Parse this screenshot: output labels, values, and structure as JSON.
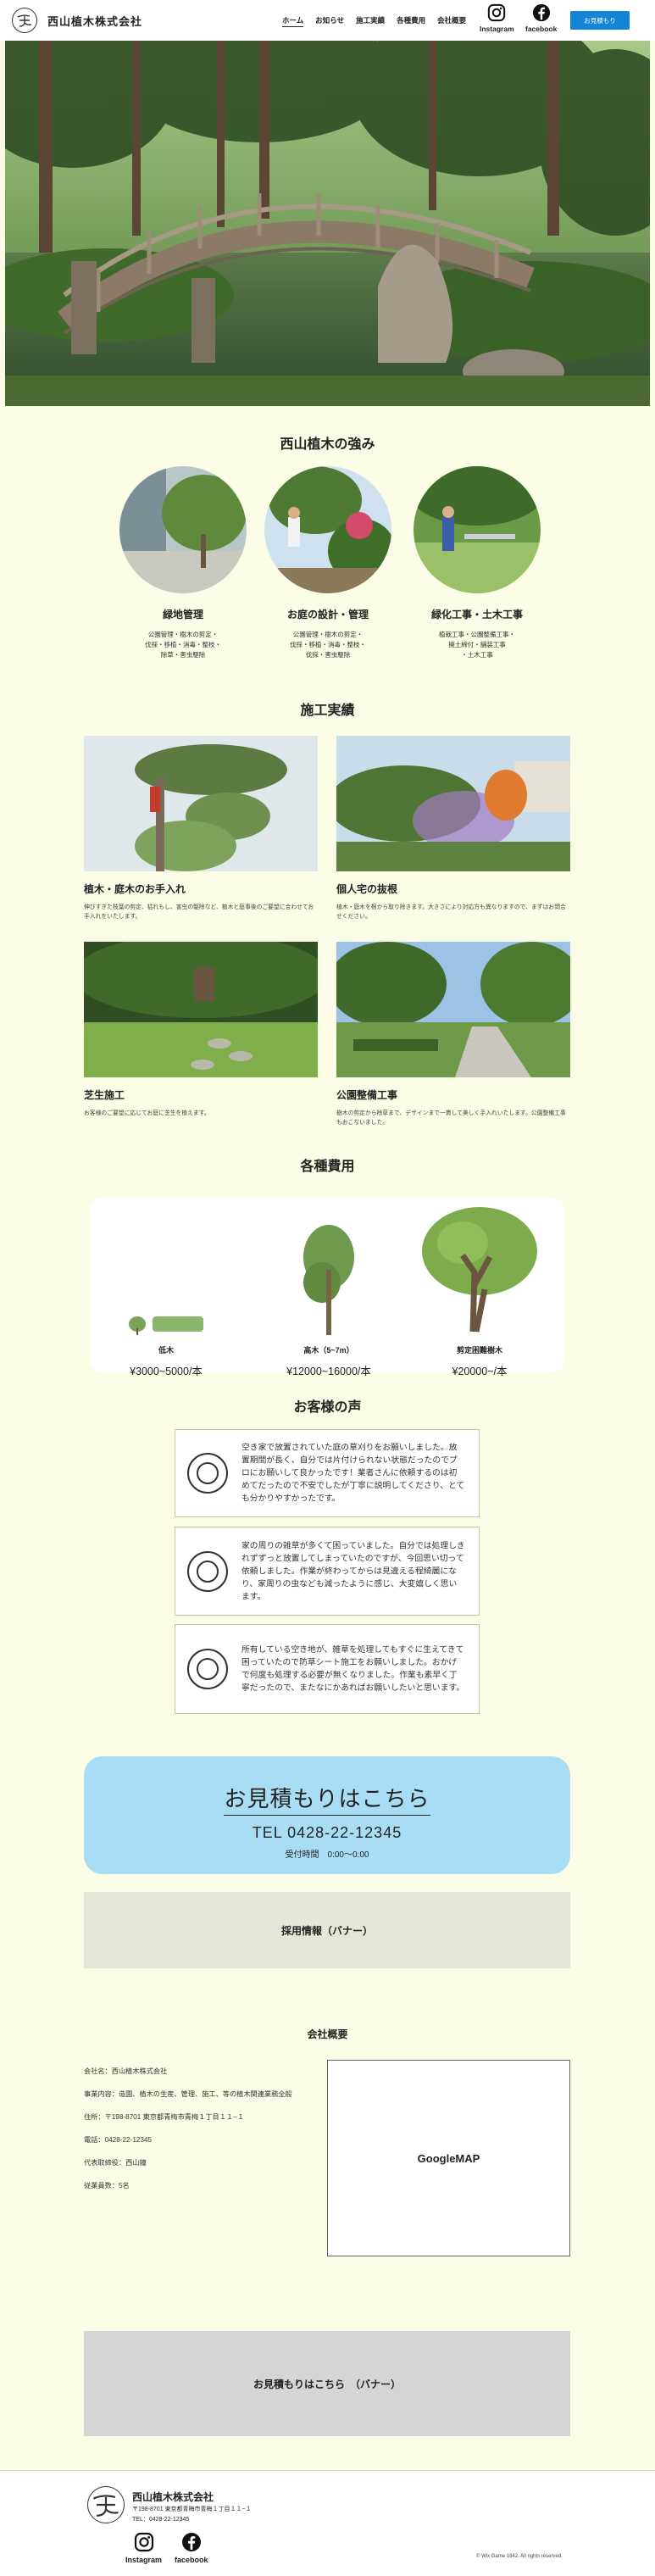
{
  "header": {
    "brand": "西山植木株式会社",
    "nav": [
      "ホーム",
      "お知らせ",
      "施工実績",
      "各種費用",
      "会社概要"
    ],
    "sns": {
      "instagram": "Instagram",
      "facebook": "facebook"
    },
    "estimate_button": "お見積もり"
  },
  "strengths": {
    "title": "西山植木の強み",
    "items": [
      {
        "title": "緑地管理",
        "lines": [
          "公園管理・樹木の剪定・",
          "伐採・移植・消毒・整枝・",
          "除草・害虫駆除"
        ]
      },
      {
        "title": "お庭の設計・管理",
        "lines": [
          "公園管理・樹木の剪定・",
          "伐採・移植・消毒・整枝・",
          "伐採・害虫駆除"
        ]
      },
      {
        "title": "緑化工事・土木工事",
        "lines": [
          "植栽工事・公園整備工事・",
          "擁土締付・舗装工事",
          "・土木工事"
        ]
      }
    ]
  },
  "works": {
    "title": "施工実績",
    "items": [
      {
        "title": "植木・庭木のお手入れ",
        "text": "伸びすぎた枝葉の剪定、枯れもし、害虫の駆除など、植木と庭事後のご要望に合わせてお手入れをいたします。"
      },
      {
        "title": "個人宅の抜根",
        "text": "植木・庭木を根から取り除きます。大きさにより対応方も異なりますので、まずはお問合せください。"
      },
      {
        "title": "芝生施工",
        "text": "お客様のご要望に応じてお庭に芝生を植えます。"
      },
      {
        "title": "公園整備工事",
        "text": "樹木の剪定から除草まで、デザインまで一貫して美しく手入れいたします。公園整備工事もおこないました。"
      }
    ]
  },
  "costs": {
    "title": "各種費用",
    "items": [
      {
        "name": "低木",
        "price": "¥3000~5000/本"
      },
      {
        "name": "高木（5~7m）",
        "price": "¥12000~16000/本"
      },
      {
        "name": "剪定困難樹木",
        "price": "¥20000~/本"
      }
    ]
  },
  "voices": {
    "title": "お客様の声",
    "items": [
      "空き家で放置されていた庭の草刈りをお願いしました。放置期間が長く、自分では片付けられない状態だったのでプロにお願いして良かったです！業者さんに依頼するのは初めてだったので不安でしたが丁寧に説明してくださり、とても分かりやすかったです。",
      "家の周りの雑草が多くて困っていました。自分では処理しきれずずっと放置してしまっていたのですが、今回思い切って依頼しました。作業が終わってからは見違える程綺麗になり、家周りの虫なども減ったように感じ、大変嬉しく思います。",
      "所有している空き地が、雑草を処理してもすぐに生えてきて困っていたので防草シート施工をお願いしました。おかげで何度も処理する必要が無くなりました。作業も素早く丁寧だったので、またなにかあればお願いしたいと思います。"
    ]
  },
  "contact": {
    "title": "お見積もりはこちら",
    "tel": "TEL 0428-22-12345",
    "hours": "受付時間　0:00〜0:00"
  },
  "recruit_banner": "採用情報（バナー）",
  "company": {
    "title": "会社概要",
    "rows": [
      "会社名：西山植木株式会社",
      "事業内容：造園、植木の生産、管理、施工、等の植木関連業務全般",
      "住所：〒198-8701 東京都青梅市青梅１丁目１１−１",
      "電話：0428-22-12345",
      "代表取締役：西山鐘",
      "従業員数：5名"
    ],
    "map_label": "GoogleMAP"
  },
  "estimate_banner": "お見積もりはこちら　（バナー）",
  "footer": {
    "brand": "西山植木株式会社",
    "address": "〒198-8701 東京都青梅市青梅１丁目１１−１",
    "tel": "TEL：0428-22-12345",
    "instagram": "Instagram",
    "facebook": "facebook",
    "copyright": "© Wix Game 1842. All rights reserved."
  },
  "colors": {
    "page_bg": "#fbfde6",
    "accent_blue": "#1484d6",
    "contact_bg": "#a9ddf6",
    "card_border": "#c9c9a0"
  }
}
